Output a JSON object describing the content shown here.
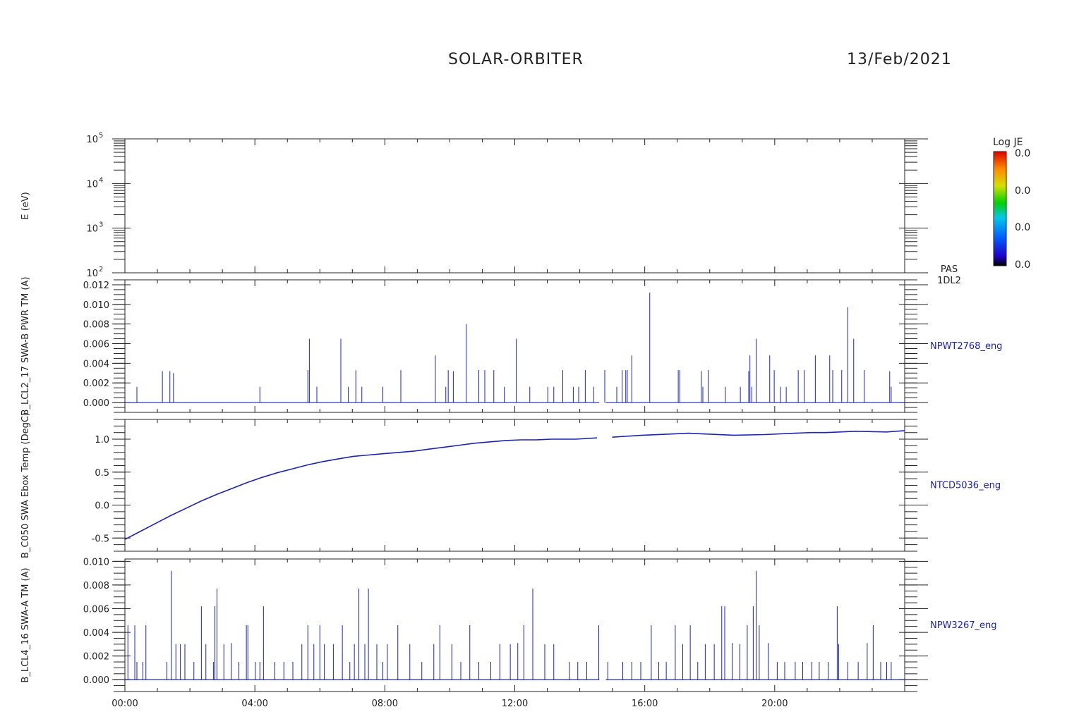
{
  "header": {
    "title": "SOLAR-ORBITER",
    "date": "13/Feb/2021"
  },
  "colors": {
    "axis": "#222222",
    "data": "#1a24b0"
  },
  "colorbar": {
    "label": "Log JE",
    "ticks": [
      "0.0",
      "0.0",
      "0.0",
      "0.0"
    ]
  },
  "chart_data": [
    {
      "type": "heatmap",
      "panel": "energy",
      "ylabel": "E (eV)",
      "yscale": "log",
      "ylim": [
        100,
        100000
      ],
      "ytick_exponents": [
        "2",
        "3",
        "4",
        "5"
      ],
      "right_label": [
        "PAS",
        "1DL2"
      ],
      "values": []
    },
    {
      "type": "line",
      "panel": "npwt2768",
      "ylabel": "B_LCL2_17 SWA-B PWR TM (A)",
      "series_name": "NPWT2768_eng",
      "ylim": [
        -0.001,
        0.0125
      ],
      "yticks": [
        "0.000",
        "0.002",
        "0.004",
        "0.006",
        "0.008",
        "0.010",
        "0.012"
      ],
      "baseline": 0,
      "gap": [
        14.6,
        14.8
      ],
      "spikes": [
        [
          0.4,
          0.0016
        ],
        [
          1.25,
          0.0032
        ],
        [
          1.5,
          0.0032
        ],
        [
          1.62,
          0.003
        ],
        [
          4.5,
          0.0016
        ],
        [
          6.1,
          0.0033
        ],
        [
          6.15,
          0.0065
        ],
        [
          6.4,
          0.0016
        ],
        [
          7.2,
          0.0065
        ],
        [
          7.45,
          0.0016
        ],
        [
          7.7,
          0.0033
        ],
        [
          7.9,
          0.0016
        ],
        [
          8.6,
          0.0016
        ],
        [
          9.2,
          0.0033
        ],
        [
          10.35,
          0.0048
        ],
        [
          10.7,
          0.0016
        ],
        [
          10.78,
          0.0033
        ],
        [
          10.95,
          0.0032
        ],
        [
          11.38,
          0.008
        ],
        [
          11.8,
          0.0033
        ],
        [
          12.0,
          0.0033
        ],
        [
          12.3,
          0.0033
        ],
        [
          12.65,
          0.0016
        ],
        [
          13.05,
          0.0065
        ],
        [
          13.5,
          0.0016
        ],
        [
          14.1,
          0.0016
        ],
        [
          14.3,
          0.0016
        ],
        [
          14.6,
          0.0033
        ],
        [
          14.95,
          0.0016
        ],
        [
          15.13,
          0.0016
        ],
        [
          15.35,
          0.0033
        ],
        [
          15.63,
          0.0016
        ],
        [
          16.0,
          0.0033
        ],
        [
          16.4,
          0.0016
        ],
        [
          16.58,
          0.0033
        ],
        [
          16.7,
          0.0033
        ],
        [
          16.75,
          0.0033
        ],
        [
          16.9,
          0.0048
        ],
        [
          17.5,
          0.0112
        ],
        [
          18.45,
          0.0033
        ],
        [
          18.5,
          0.0033
        ],
        [
          19.22,
          0.0032
        ],
        [
          19.27,
          0.0016
        ],
        [
          19.45,
          0.0033
        ],
        [
          20.02,
          0.0016
        ],
        [
          20.52,
          0.0016
        ],
        [
          20.8,
          0.0032
        ],
        [
          20.84,
          0.0048
        ],
        [
          20.9,
          0.0016
        ],
        [
          21.05,
          0.0065
        ],
        [
          21.5,
          0.0048
        ],
        [
          21.65,
          0.0033
        ],
        [
          21.86,
          0.0016
        ],
        [
          22.05,
          0.0016
        ],
        [
          22.45,
          0.0033
        ],
        [
          22.65,
          0.0033
        ],
        [
          23.02,
          0.0048
        ],
        [
          23.5,
          0.0048
        ],
        [
          23.6,
          0.0033
        ],
        [
          23.9,
          0.0033
        ],
        [
          24.1,
          0.0097
        ],
        [
          24.3,
          0.0065
        ],
        [
          24.65,
          0.0033
        ],
        [
          25.5,
          0.0032
        ],
        [
          25.55,
          0.0016
        ]
      ]
    },
    {
      "type": "line",
      "panel": "ntcd5036",
      "ylabel": "B_C050 SWA Ebox Temp (DegC)",
      "series_name": "NTCD5036_eng",
      "ylim": [
        -0.7,
        1.3
      ],
      "yticks": [
        "-0.5",
        "0.0",
        "0.5",
        "1.0"
      ],
      "gap": [
        14.6,
        14.8
      ],
      "x": [
        0,
        0.5,
        1,
        1.5,
        2,
        2.5,
        3,
        3.5,
        4,
        4.5,
        5,
        5.5,
        6,
        6.5,
        7,
        7.5,
        8,
        8.5,
        9,
        9.5,
        10,
        10.5,
        11,
        11.5,
        12,
        12.5,
        13,
        13.5,
        14,
        14.5,
        14.8,
        15.5,
        16,
        17,
        18,
        18.5,
        19,
        20,
        21,
        22,
        22.5,
        23,
        24,
        25,
        25.6
      ],
      "y": [
        -0.52,
        -0.4,
        -0.28,
        -0.16,
        -0.05,
        0.06,
        0.16,
        0.25,
        0.34,
        0.42,
        0.49,
        0.55,
        0.61,
        0.66,
        0.7,
        0.74,
        0.76,
        0.78,
        0.8,
        0.82,
        0.85,
        0.88,
        0.91,
        0.94,
        0.96,
        0.98,
        0.99,
        0.99,
        1.0,
        1.0,
        1.0,
        1.02,
        1.03,
        1.06,
        1.08,
        1.09,
        1.08,
        1.06,
        1.07,
        1.09,
        1.1,
        1.1,
        1.12,
        1.11,
        1.13
      ]
    },
    {
      "type": "line",
      "panel": "npw3267",
      "ylabel": "B_LCL4_16 SWA-A TM (A)",
      "series_name": "NPW3267_eng",
      "ylim": [
        -0.001,
        0.0102
      ],
      "yticks": [
        "0.000",
        "0.002",
        "0.004",
        "0.006",
        "0.008",
        "0.010"
      ],
      "xticks": [
        "00:00",
        "04:00",
        "08:00",
        "12:00",
        "16:00",
        "20:00"
      ],
      "xtick_hours": [
        0,
        4,
        8,
        12,
        16,
        20
      ],
      "xlim": [
        0,
        24
      ],
      "baseline": 0,
      "gap": [
        14.6,
        14.8
      ],
      "spikes": [
        [
          0.1,
          0.0046
        ],
        [
          0.33,
          0.0046
        ],
        [
          0.4,
          0.0015
        ],
        [
          0.6,
          0.0015
        ],
        [
          0.7,
          0.0046
        ],
        [
          1.4,
          0.0015
        ],
        [
          1.55,
          0.0092
        ],
        [
          1.7,
          0.003
        ],
        [
          1.85,
          0.003
        ],
        [
          2.0,
          0.003
        ],
        [
          2.3,
          0.0015
        ],
        [
          2.55,
          0.0062
        ],
        [
          2.7,
          0.003
        ],
        [
          2.95,
          0.0015
        ],
        [
          3.0,
          0.0062
        ],
        [
          3.07,
          0.0077
        ],
        [
          3.3,
          0.003
        ],
        [
          3.55,
          0.0031
        ],
        [
          3.8,
          0.0015
        ],
        [
          4.05,
          0.0046
        ],
        [
          4.1,
          0.0046
        ],
        [
          4.35,
          0.0015
        ],
        [
          4.5,
          0.0015
        ],
        [
          4.62,
          0.0062
        ],
        [
          5.0,
          0.0015
        ],
        [
          5.3,
          0.0015
        ],
        [
          5.6,
          0.0015
        ],
        [
          5.9,
          0.003
        ],
        [
          6.1,
          0.0046
        ],
        [
          6.3,
          0.003
        ],
        [
          6.5,
          0.0046
        ],
        [
          6.65,
          0.003
        ],
        [
          6.95,
          0.003
        ],
        [
          7.25,
          0.0046
        ],
        [
          7.5,
          0.0015
        ],
        [
          7.65,
          0.003
        ],
        [
          7.8,
          0.0077
        ],
        [
          8.0,
          0.003
        ],
        [
          8.12,
          0.0077
        ],
        [
          8.4,
          0.003
        ],
        [
          8.6,
          0.0015
        ],
        [
          8.75,
          0.003
        ],
        [
          9.1,
          0.0046
        ],
        [
          9.5,
          0.003
        ],
        [
          9.9,
          0.0015
        ],
        [
          10.3,
          0.003
        ],
        [
          10.5,
          0.0046
        ],
        [
          10.9,
          0.003
        ],
        [
          11.2,
          0.0015
        ],
        [
          11.5,
          0.0046
        ],
        [
          11.8,
          0.0015
        ],
        [
          12.2,
          0.0015
        ],
        [
          12.5,
          0.003
        ],
        [
          12.85,
          0.003
        ],
        [
          13.1,
          0.0031
        ],
        [
          13.3,
          0.0046
        ],
        [
          13.6,
          0.0077
        ],
        [
          14.0,
          0.003
        ],
        [
          14.3,
          0.003
        ],
        [
          14.82,
          0.0015
        ],
        [
          15.1,
          0.0015
        ],
        [
          15.4,
          0.0015
        ],
        [
          15.8,
          0.0046
        ],
        [
          16.1,
          0.0015
        ],
        [
          16.6,
          0.0015
        ],
        [
          16.9,
          0.0015
        ],
        [
          17.2,
          0.0015
        ],
        [
          17.55,
          0.0046
        ],
        [
          17.8,
          0.0015
        ],
        [
          18.05,
          0.0015
        ],
        [
          18.35,
          0.0046
        ],
        [
          18.6,
          0.003
        ],
        [
          18.85,
          0.0046
        ],
        [
          19.1,
          0.0015
        ],
        [
          19.35,
          0.003
        ],
        [
          19.65,
          0.003
        ],
        [
          19.9,
          0.0062
        ],
        [
          20.0,
          0.0062
        ],
        [
          20.25,
          0.0031
        ],
        [
          20.5,
          0.003
        ],
        [
          20.75,
          0.0046
        ],
        [
          20.95,
          0.0062
        ],
        [
          21.05,
          0.0092
        ],
        [
          21.15,
          0.0046
        ],
        [
          21.45,
          0.0031
        ],
        [
          21.75,
          0.0015
        ],
        [
          22.0,
          0.0015
        ],
        [
          22.35,
          0.0015
        ],
        [
          22.6,
          0.0015
        ],
        [
          22.9,
          0.0015
        ],
        [
          23.15,
          0.0015
        ],
        [
          23.45,
          0.0015
        ],
        [
          23.75,
          0.0062
        ],
        [
          23.8,
          0.003
        ],
        [
          24.1,
          0.0015
        ],
        [
          24.45,
          0.0015
        ],
        [
          24.75,
          0.0031
        ],
        [
          24.95,
          0.0046
        ],
        [
          25.2,
          0.0015
        ],
        [
          25.4,
          0.0015
        ],
        [
          25.55,
          0.0015
        ]
      ]
    }
  ]
}
